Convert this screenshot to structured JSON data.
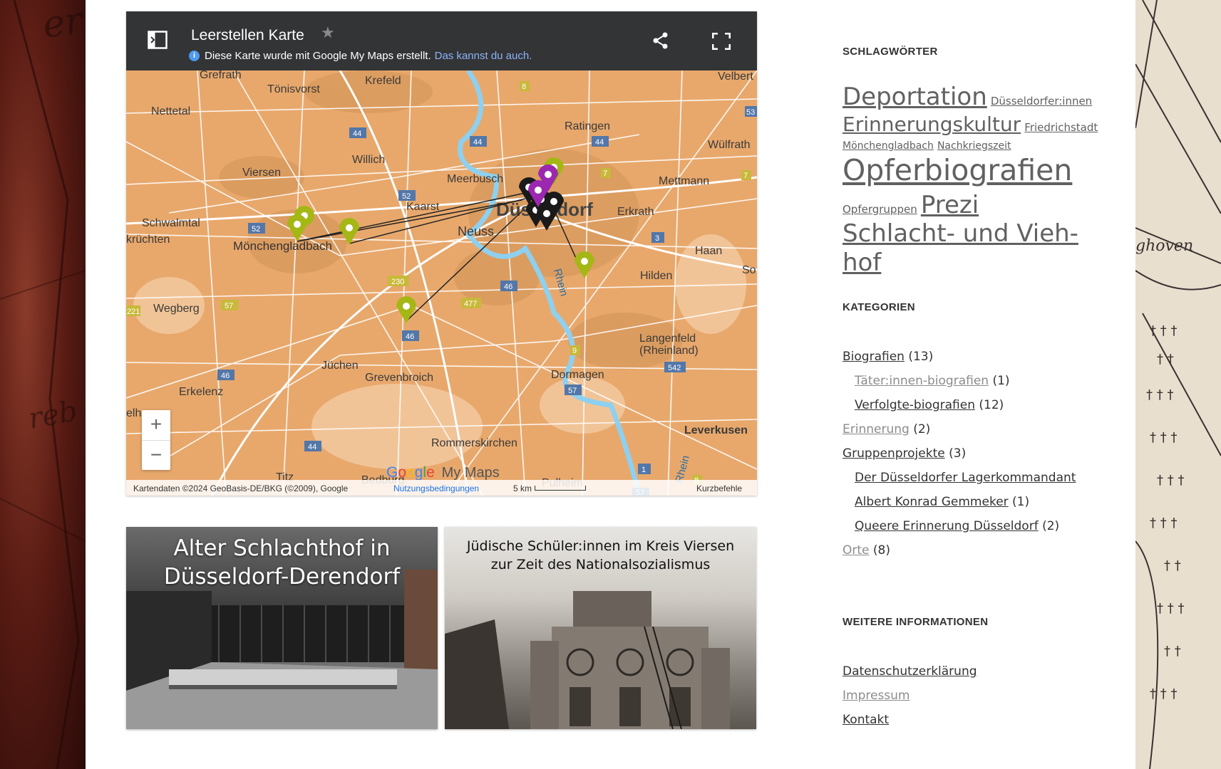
{
  "map": {
    "title": "Leerstellen Karte",
    "info_text": "Diese Karte wurde mit Google My Maps erstellt.",
    "info_link": "Das kannst du auch.",
    "brand_suffix": "My Maps",
    "attribution": "Kartendaten ©2024 GeoBasis-DE/BKG (©2009), Google",
    "terms": "Nutzungsbedingungen",
    "scale": "5 km",
    "shortcuts": "Kurzbefehle",
    "zoom_in": "+",
    "zoom_out": "−",
    "cities": [
      "Grefrath",
      "Krefeld",
      "Velbert",
      "Tönisvorst",
      "Nettetal",
      "Ratingen",
      "Wülfrath",
      "Willich",
      "Viersen",
      "Meerbusch",
      "Mettmann",
      "Düsseldorf",
      "Erkrath",
      "Kaarst",
      "Schwalmtal",
      "krüchten",
      "Mönchengladbach",
      "Neuss",
      "Haan",
      "Hilden",
      "So",
      "Wegberg",
      "Langenfeld",
      "(Rheinland)",
      "Jüchen",
      "Grevenbroich",
      "Dormagen",
      "Erkelenz",
      "Leverkusen",
      "Rommerskirchen",
      "Titz",
      "Bedburg",
      "Pulheim",
      "Rhein",
      "Rhein",
      "elhoven"
    ],
    "roads": [
      "8",
      "44",
      "44",
      "44",
      "53",
      "52",
      "7",
      "7",
      "52",
      "3",
      "230",
      "46",
      "477",
      "57",
      "221",
      "46",
      "9",
      "542",
      "46",
      "57",
      "1",
      "44",
      "8",
      "57"
    ],
    "colors": {
      "green_pin": "#a4b714",
      "purple_pin": "#9c27b0",
      "black_pin": "#1a1a1a",
      "land": "#e8a86c",
      "water": "#8ed0f0",
      "header": "#333436"
    }
  },
  "thumbs": [
    {
      "title_line1": "Alter Schlachthof in",
      "title_line2": "Düsseldorf-Derendorf"
    },
    {
      "title_line1": "Jüdische Schüler:innen im Kreis Viersen",
      "title_line2": "zur Zeit des Nationalsozialismus"
    }
  ],
  "sidebar": {
    "tags_title": "Schlagwörter",
    "tags": [
      {
        "label": "Deportation"
      },
      {
        "label": "Düsseldorfer:innen"
      },
      {
        "label": "Erinnerungskultur"
      },
      {
        "label": "Friedrichstadt"
      },
      {
        "label": "Mönchengladbach"
      },
      {
        "label": "Nachkriegszeit"
      },
      {
        "label": "Opferbiografien"
      },
      {
        "label": "Opfergruppen"
      },
      {
        "label": "Prezi"
      },
      {
        "label": "Schlacht- und Vieh-"
      },
      {
        "label": "hof"
      }
    ],
    "categories_title": "Kategorien",
    "categories": [
      {
        "label": "Biografien",
        "count": "(13)"
      },
      {
        "label": "Täter:innen-biografien",
        "count": "(1)"
      },
      {
        "label": "Verfolgte-biografien",
        "count": "(12)"
      },
      {
        "label": "Erinnerung",
        "count": "(2)"
      },
      {
        "label": "Gruppenprojekte",
        "count": "(3)"
      },
      {
        "label": "Der Düsseldorfer Lagerkommandant",
        "count": ""
      },
      {
        "label": "Albert Konrad Gemmeker",
        "count": "(1)"
      },
      {
        "label": "Queere Erinnerung Düsseldorf",
        "count": "(2)"
      },
      {
        "label": "Orte",
        "count": "(8)"
      }
    ],
    "more_title": "Weitere Informationen",
    "more_links": [
      {
        "label": "Datenschutzerklärung"
      },
      {
        "label": "Impressum"
      },
      {
        "label": "Kontakt"
      }
    ]
  }
}
